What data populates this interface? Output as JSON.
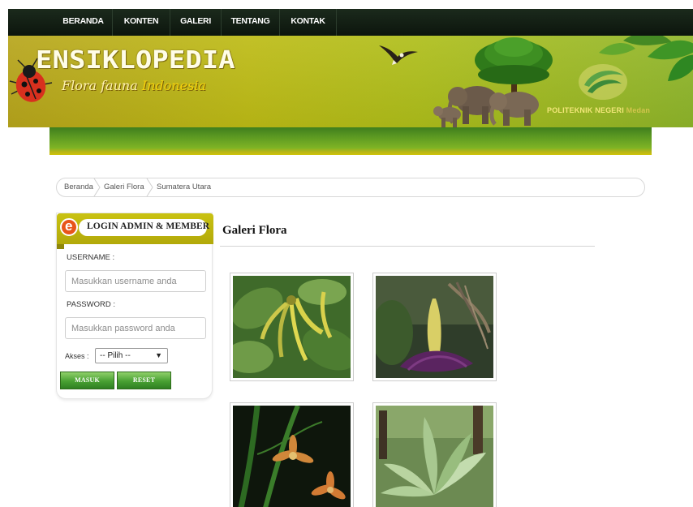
{
  "nav": {
    "items": [
      "BERANDA",
      "KONTEN",
      "GALERI",
      "TENTANG",
      "KONTAK"
    ]
  },
  "banner": {
    "title": "ENSIKLOPEDIA",
    "subtitle_main": "Flora fauna",
    "subtitle_accent": "Indonesia",
    "institution": "POLITEKNIK NEGERI",
    "institution_suffix": "Medan"
  },
  "breadcrumb": {
    "items": [
      "Beranda",
      "Galeri Flora",
      "Sumatera Utara"
    ]
  },
  "login": {
    "title": "LOGIN ADMIN & MEMBER",
    "icon_letter": "e",
    "username_label": "USERNAME :",
    "username_placeholder": "Masukkan username anda",
    "password_label": "PASSWORD :",
    "password_placeholder": "Masukkan password anda",
    "akses_label": "Akses :",
    "akses_selected": "-- Pilih --",
    "submit_label": "MASUK",
    "reset_label": "RESET"
  },
  "gallery": {
    "title": "Galeri Flora"
  },
  "icons": {
    "ladybug": "ladybug-icon",
    "eagle": "eagle-icon",
    "dropdown": "caret-down-icon"
  },
  "colors": {
    "nav_bg": "#111c12",
    "banner_yellow": "#bdbb15",
    "greenbar": "#5d9a22",
    "button_green": "#48a032",
    "login_header": "#c2bb10",
    "badge_orange": "#e8551b"
  }
}
